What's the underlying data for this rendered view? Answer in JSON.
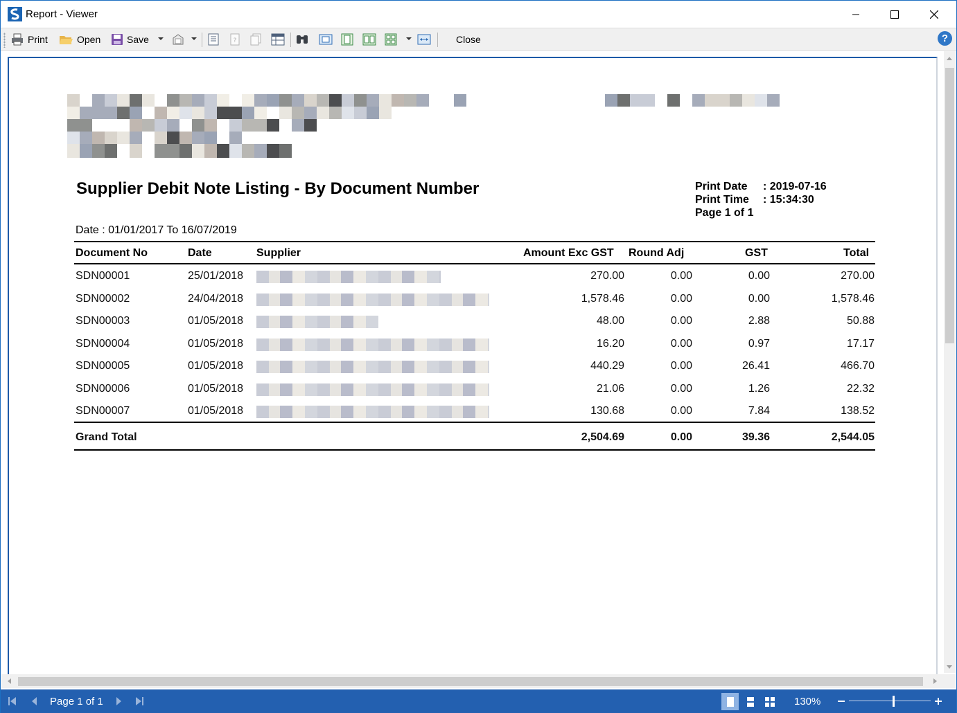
{
  "window": {
    "title": "Report - Viewer",
    "accent": "#1d6fc2"
  },
  "toolbar": {
    "print_label": "Print",
    "open_label": "Open",
    "save_label": "Save",
    "close_label": "Close"
  },
  "report": {
    "title": "Supplier Debit Note Listing - By Document Number",
    "print_date_label": "Print Date",
    "print_date_value": ": 2019-07-16",
    "print_time_label": "Print Time",
    "print_time_value": ": 15:34:30",
    "page_info": "Page 1 of 1",
    "date_range": "Date : 01/01/2017 To 16/07/2019",
    "columns": {
      "doc_no": "Document No",
      "date": "Date",
      "supplier": "Supplier",
      "amount": "Amount Exc GST",
      "round_adj": "Round Adj",
      "gst": "GST",
      "total": "Total"
    },
    "rows": [
      {
        "doc_no": "SDN00001",
        "date": "25/01/2018",
        "amount": "270.00",
        "round_adj": "0.00",
        "gst": "0.00",
        "total": "270.00"
      },
      {
        "doc_no": "SDN00002",
        "date": "24/04/2018",
        "amount": "1,578.46",
        "round_adj": "0.00",
        "gst": "0.00",
        "total": "1,578.46"
      },
      {
        "doc_no": "SDN00003",
        "date": "01/05/2018",
        "amount": "48.00",
        "round_adj": "0.00",
        "gst": "2.88",
        "total": "50.88"
      },
      {
        "doc_no": "SDN00004",
        "date": "01/05/2018",
        "amount": "16.20",
        "round_adj": "0.00",
        "gst": "0.97",
        "total": "17.17"
      },
      {
        "doc_no": "SDN00005",
        "date": "01/05/2018",
        "amount": "440.29",
        "round_adj": "0.00",
        "gst": "26.41",
        "total": "466.70"
      },
      {
        "doc_no": "SDN00006",
        "date": "01/05/2018",
        "amount": "21.06",
        "round_adj": "0.00",
        "gst": "1.26",
        "total": "22.32"
      },
      {
        "doc_no": "SDN00007",
        "date": "01/05/2018",
        "amount": "130.68",
        "round_adj": "0.00",
        "gst": "7.84",
        "total": "138.52"
      }
    ],
    "grand_total": {
      "label": "Grand Total",
      "amount": "2,504.69",
      "round_adj": "0.00",
      "gst": "39.36",
      "total": "2,544.05"
    }
  },
  "status_bar": {
    "page_label": "Page 1 of 1",
    "zoom": "130%",
    "background": "#2360b0"
  }
}
